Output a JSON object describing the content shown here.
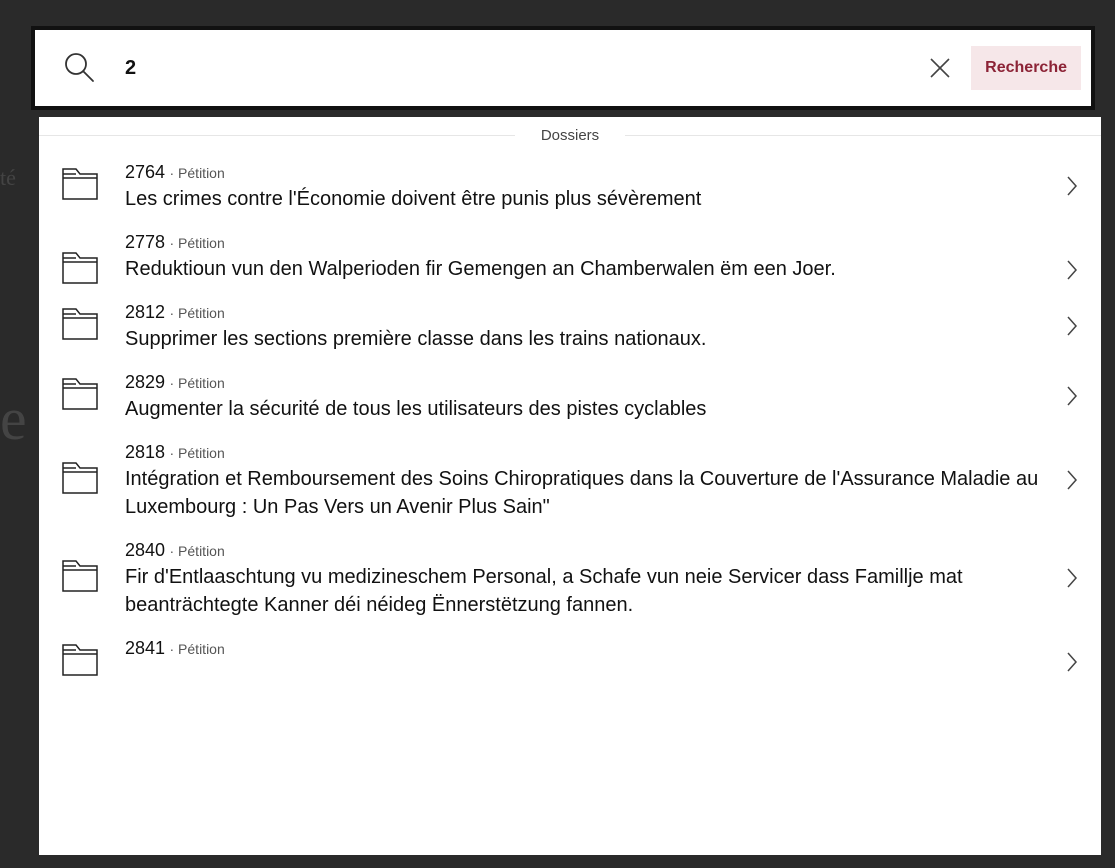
{
  "search": {
    "value": "2",
    "submit_label": "Recherche"
  },
  "results": {
    "section_label": "Dossiers",
    "items": [
      {
        "number": "2764",
        "type": "· Pétition",
        "title": "Les crimes contre l'Économie doivent être punis plus sévèrement"
      },
      {
        "number": "2778",
        "type": "· Pétition",
        "title": "Reduktioun vun den Walperioden fir Gemengen an Chamberwalen ëm een Joer."
      },
      {
        "number": "2812",
        "type": "· Pétition",
        "title": "Supprimer les sections première classe dans les trains nationaux."
      },
      {
        "number": "2829",
        "type": "· Pétition",
        "title": "Augmenter la sécurité de tous les utilisateurs des pistes cyclables"
      },
      {
        "number": "2818",
        "type": "· Pétition",
        "title": "Intégration et Remboursement des Soins Chiropratiques dans la Couverture de l'Assurance Maladie au Luxembourg : Un Pas Vers un Avenir Plus Sain\""
      },
      {
        "number": "2840",
        "type": "· Pétition",
        "title": "Fir d'Entlaaschtung vu medizineschem Personal, a Schafe vun neie Servicer dass Famillje mat beanträchtegte Kanner déi néideg Ënnerstëtzung fannen."
      },
      {
        "number": "2841",
        "type": "· Pétition",
        "title": ""
      }
    ]
  },
  "colors": {
    "accent": "#8c2336",
    "accent_bg": "#f6e7e9",
    "overlay": "#2a2a2a"
  },
  "icons": {
    "search": "search-icon",
    "clear": "close-icon",
    "folder": "folder-icon",
    "chevron": "chevron-right-icon"
  }
}
